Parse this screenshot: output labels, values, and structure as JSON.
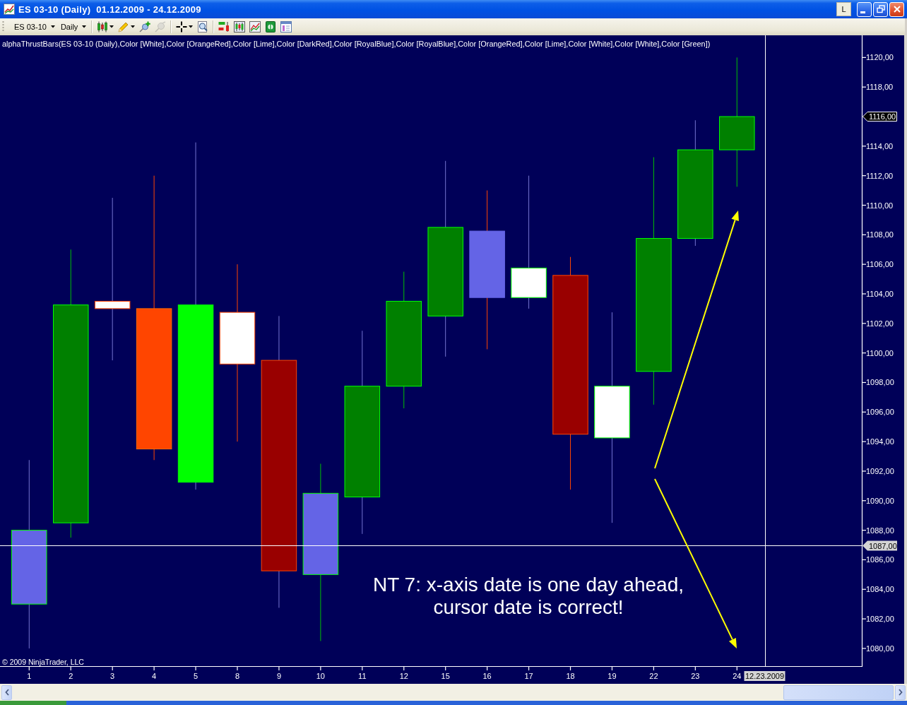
{
  "window": {
    "title": "ES 03-10 (Daily)  01.12.2009 - 24.12.2009",
    "buttons": [
      {
        "kind": "text",
        "label": "L"
      },
      {
        "kind": "minimize"
      },
      {
        "kind": "restore"
      },
      {
        "kind": "close"
      }
    ]
  },
  "toolbar": {
    "instrument": "ES 03-10",
    "interval": "Daily",
    "tool_groups": [
      [
        {
          "kind": "candles",
          "dropdown": true,
          "disabled": false
        },
        {
          "kind": "pencil",
          "dropdown": true,
          "disabled": false
        },
        {
          "kind": "pin-plus",
          "dropdown": false,
          "disabled": false
        },
        {
          "kind": "pin",
          "dropdown": false,
          "disabled": true
        }
      ],
      [
        {
          "kind": "crosshair",
          "dropdown": true,
          "disabled": false
        },
        {
          "kind": "magnifier",
          "dropdown": false,
          "disabled": false
        }
      ],
      [
        {
          "kind": "bars",
          "dropdown": false,
          "disabled": false
        },
        {
          "kind": "candles-box",
          "dropdown": false,
          "disabled": false
        },
        {
          "kind": "line-box",
          "dropdown": false,
          "disabled": false
        },
        {
          "kind": "money",
          "dropdown": false,
          "disabled": false
        },
        {
          "kind": "panel",
          "dropdown": false,
          "disabled": false
        }
      ]
    ]
  },
  "chart": {
    "indicator_label": "alphaThrustBars(ES 03-10 (Daily),Color [White],Color [OrangeRed],Color [Lime],Color [DarkRed],Color [RoyalBlue],Color [RoyalBlue],Color [OrangeRed],Color [Lime],Color [White],Color [White],Color [Green])",
    "price_axis": [
      {
        "kind": "tick",
        "label": "1120,00"
      },
      {
        "kind": "tick",
        "label": "1118,00"
      },
      {
        "kind": "last_price",
        "label": "1116,00"
      },
      {
        "kind": "tick",
        "label": "1114,00"
      },
      {
        "kind": "tick",
        "label": "1112,00"
      },
      {
        "kind": "tick",
        "label": "1110,00"
      },
      {
        "kind": "tick",
        "label": "1108,00"
      },
      {
        "kind": "tick",
        "label": "1106,00"
      },
      {
        "kind": "tick",
        "label": "1104,00"
      },
      {
        "kind": "tick",
        "label": "1102,00"
      },
      {
        "kind": "tick",
        "label": "1100,00"
      },
      {
        "kind": "tick",
        "label": "1098,00"
      },
      {
        "kind": "tick",
        "label": "1096,00"
      },
      {
        "kind": "tick",
        "label": "1094,00"
      },
      {
        "kind": "tick",
        "label": "1092,00"
      },
      {
        "kind": "tick",
        "label": "1090,00"
      },
      {
        "kind": "tick",
        "label": "1088,00"
      },
      {
        "kind": "tick",
        "label": "1086,00"
      },
      {
        "kind": "tick",
        "label": "1084,00"
      },
      {
        "kind": "tick",
        "label": "1082,00"
      },
      {
        "kind": "tick",
        "label": "1080,00"
      }
    ],
    "cursor_price_tag": "1087,00",
    "date_axis_labels": [
      "1",
      "2",
      "3",
      "4",
      "5",
      "8",
      "9",
      "10",
      "11",
      "12",
      "15",
      "16",
      "17",
      "18",
      "19",
      "22",
      "23",
      "24"
    ],
    "cursor_date_tag": "12.23.2009",
    "note": [
      "NT 7: x-axis date is one day ahead,",
      "cursor date is correct!"
    ],
    "copyright": "© 2009 NinjaTrader, LLC"
  }
}
